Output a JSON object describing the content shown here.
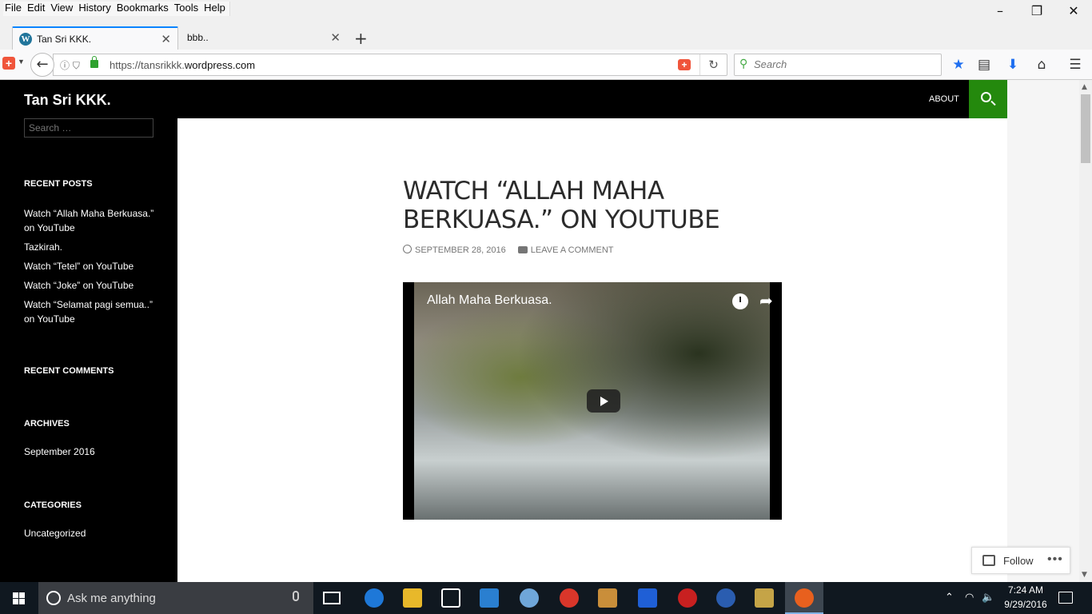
{
  "browser": {
    "menu": [
      "File",
      "Edit",
      "View",
      "History",
      "Bookmarks",
      "Tools",
      "Help"
    ],
    "tabs": [
      {
        "title": "Tan Sri KKK.",
        "active": true
      },
      {
        "title": "bbb..",
        "active": false
      }
    ],
    "url_prefix": "https://tansrikkk.",
    "url_domain": "wordpress.com",
    "search_placeholder": "Search"
  },
  "site": {
    "title": "Tan Sri KKK.",
    "nav_about": "ABOUT",
    "accent_color": "#24890d",
    "sidebar_search_placeholder": "Search …",
    "widgets": {
      "recent_posts_title": "RECENT POSTS",
      "recent_posts": [
        "Watch “Allah Maha Berkuasa.” on YouTube",
        "Tazkirah.",
        "Watch “Tetel” on YouTube",
        "Watch “Joke” on YouTube",
        "Watch “Selamat pagi semua..” on YouTube"
      ],
      "recent_comments_title": "RECENT COMMENTS",
      "archives_title": "ARCHIVES",
      "archives": [
        "September 2016"
      ],
      "categories_title": "CATEGORIES",
      "categories": [
        "Uncategorized"
      ]
    }
  },
  "post": {
    "title": "WATCH “ALLAH MAHA BERKUASA.” ON YOUTUBE",
    "date": "SEPTEMBER 28, 2016",
    "comment_link": "LEAVE A COMMENT",
    "video_title": "Allah Maha Berkuasa."
  },
  "follow_label": "Follow",
  "taskbar": {
    "cortana_placeholder": "Ask me anything",
    "time": "7:24 AM",
    "date": "9/29/2016"
  }
}
